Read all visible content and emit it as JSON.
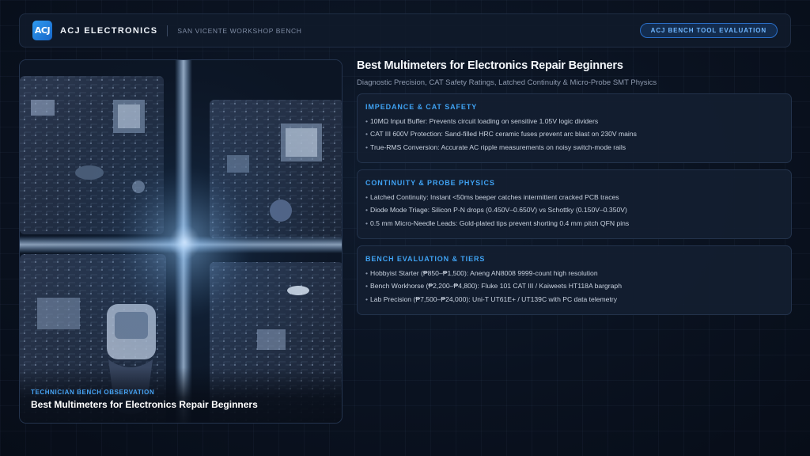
{
  "header": {
    "logo_text": "ACJ",
    "brand": "ACJ ELECTRONICS",
    "location": "SAN VICENTE WORKSHOP BENCH",
    "badge": "ACJ BENCH TOOL EVALUATION"
  },
  "photo": {
    "kicker": "TECHNICIAN BENCH OBSERVATION",
    "title": "Best Multimeters for Electronics Repair Beginners"
  },
  "article": {
    "title": "Best Multimeters for Electronics Repair Beginners",
    "subtitle": "Diagnostic Precision, CAT Safety Ratings, Latched Continuity & Micro-Probe SMT Physics"
  },
  "sections": [
    {
      "title": "IMPEDANCE & CAT SAFETY",
      "items": [
        "10MΩ Input Buffer: Prevents circuit loading on sensitive 1.05V logic dividers",
        "CAT III 600V Protection: Sand-filled HRC ceramic fuses prevent arc blast on 230V mains",
        "True-RMS Conversion: Accurate AC ripple measurements on noisy switch-mode rails"
      ]
    },
    {
      "title": "CONTINUITY & PROBE PHYSICS",
      "items": [
        "Latched Continuity: Instant <50ms beeper catches intermittent cracked PCB traces",
        "Diode Mode Triage: Silicon P-N drops (0.450V–0.650V) vs Schottky (0.150V–0.350V)",
        "0.5 mm Micro-Needle Leads: Gold-plated tips prevent shorting 0.4 mm pitch QFN pins"
      ]
    },
    {
      "title": "BENCH EVALUATION & TIERS",
      "items": [
        "Hobbyist Starter (₱850–₱1,500): Aneng AN8008 9999-count high resolution",
        "Bench Workhorse (₱2,200–₱4,800): Fluke 101 CAT III / Kaiweets HT118A bargraph",
        "Lab Precision (₱7,500–₱24,000): Uni-T UT61E+ / UT139C with PC data telemetry"
      ]
    }
  ],
  "colors": {
    "accent": "#3fa2f3",
    "badge": "#6fb6ff",
    "card_bg": "#131e30",
    "page_bg": "#0a1220"
  }
}
